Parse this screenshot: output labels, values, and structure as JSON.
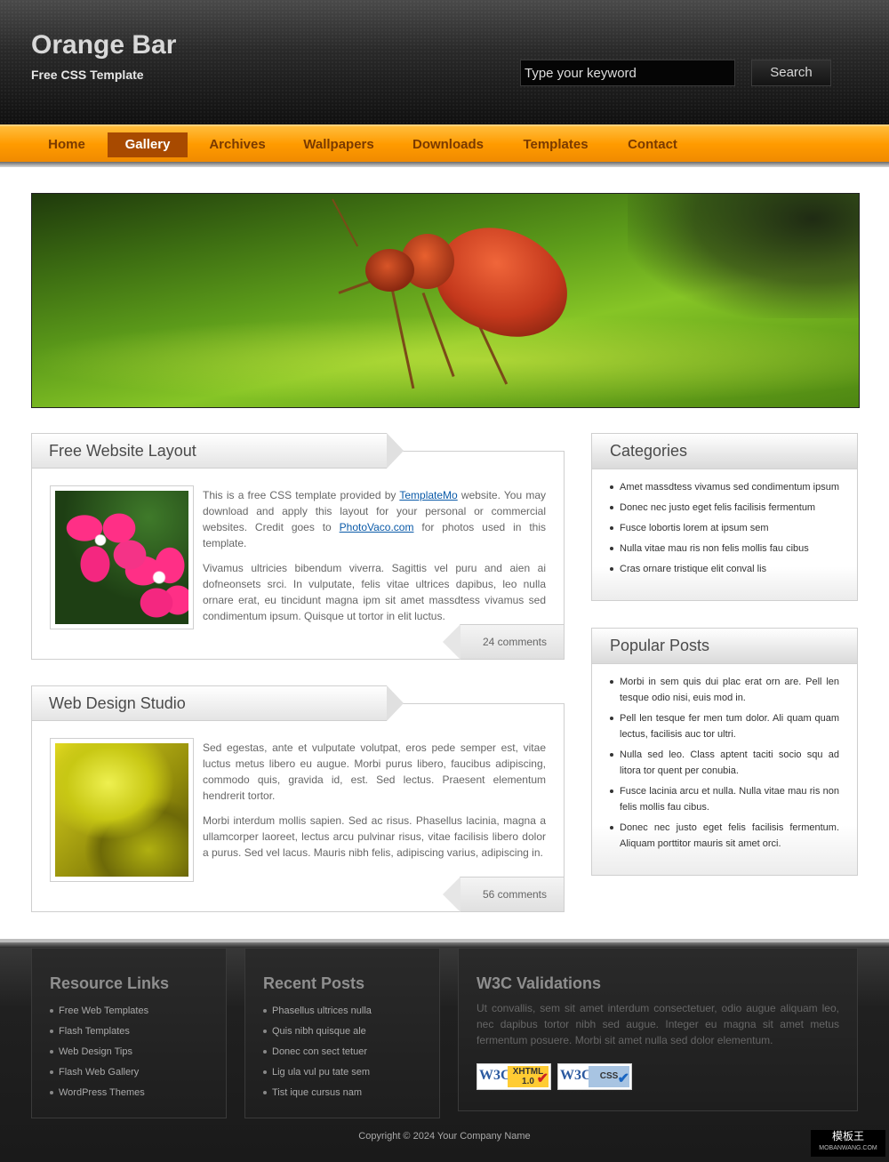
{
  "header": {
    "site_title": "Orange Bar",
    "tagline": "Free CSS Template",
    "search_placeholder": "Type your keyword",
    "search_button": "Search"
  },
  "nav": {
    "items": [
      {
        "label": "Home",
        "active": false
      },
      {
        "label": "Gallery",
        "active": true
      },
      {
        "label": "Archives",
        "active": false
      },
      {
        "label": "Wallpapers",
        "active": false
      },
      {
        "label": "Downloads",
        "active": false
      },
      {
        "label": "Templates",
        "active": false
      },
      {
        "label": "Contact",
        "active": false
      }
    ]
  },
  "posts": [
    {
      "title": "Free Website Layout",
      "p1_before": "This is a free CSS template provided by ",
      "link1": "TemplateMo",
      "p1_middle": " website. You may download and apply this layout for your personal or commercial websites. Credit goes to ",
      "link2": "PhotoVaco.com",
      "p1_after": " for photos used in this template.",
      "p2": "Vivamus ultricies bibendum viverra. Sagittis vel puru and aien ai dofneonsets srci. In vulputate, felis vitae ultrices dapibus, leo nulla ornare erat, eu tincidunt magna ipm sit amet massdtess vivamus sed condimentum ipsum. Quisque ut tortor in elit luctus.",
      "comments": "24 comments"
    },
    {
      "title": "Web Design Studio",
      "p1": "Sed egestas, ante et vulputate volutpat, eros pede semper est, vitae luctus metus libero eu augue. Morbi purus libero, faucibus adipiscing, commodo quis, gravida id, est. Sed lectus. Praesent elementum hendrerit tortor.",
      "p2": "Morbi interdum mollis sapien. Sed ac risus. Phasellus lacinia, magna a ullamcorper laoreet, lectus arcu pulvinar risus, vitae facilisis libero dolor a purus. Sed vel lacus. Mauris nibh felis, adipiscing varius, adipiscing in.",
      "comments": "56 comments"
    }
  ],
  "sidebar": {
    "categories": {
      "title": "Categories",
      "items": [
        "Amet massdtess vivamus sed condimentum ipsum",
        "Donec nec justo eget felis facilisis fermentum",
        "Fusce lobortis lorem at ipsum sem",
        "Nulla vitae mau ris non felis mollis fau cibus",
        "Cras ornare tristique elit conval lis"
      ]
    },
    "popular": {
      "title": "Popular Posts",
      "items": [
        "Morbi in sem quis dui plac erat orn are. Pell len tesque odio nisi, euis mod in.",
        "Pell len tesque fer men tum dolor. Ali quam quam lectus, facilisis auc tor ultri.",
        "Nulla sed leo. Class aptent taciti socio squ ad litora tor quent per conubia.",
        "Fusce lacinia arcu et nulla. Nulla vitae mau ris non felis mollis fau cibus.",
        "Donec nec justo eget felis facilisis fermentum. Aliquam porttitor mauris sit amet orci."
      ]
    }
  },
  "footer": {
    "resources": {
      "title": "Resource Links",
      "items": [
        "Free Web Templates",
        "Flash Templates",
        "Web Design Tips",
        "Flash Web Gallery",
        "WordPress Themes"
      ]
    },
    "recent": {
      "title": "Recent Posts",
      "items": [
        "Phasellus ultrices nulla",
        "Quis nibh quisque ale",
        "Donec con sect tetuer",
        "Lig ula vul pu tate sem",
        "Tist ique cursus nam"
      ]
    },
    "w3c": {
      "title": "W3C Validations",
      "text": "Ut convallis, sem sit amet interdum consectetuer, odio augue aliquam leo, nec dapibus tortor nibh sed augue. Integer eu magna sit amet metus fermentum posuere. Morbi sit amet nulla sed dolor elementum.",
      "badge_xhtml_w3c": "W3C",
      "badge_xhtml_label": "XHTML 1.0",
      "badge_css_w3c": "W3C",
      "badge_css_label": "CSS"
    },
    "copyright": "Copyright © 2024 Your Company Name",
    "watermark_main": "模板王",
    "watermark_sub": "MOBANWANG.COM"
  }
}
